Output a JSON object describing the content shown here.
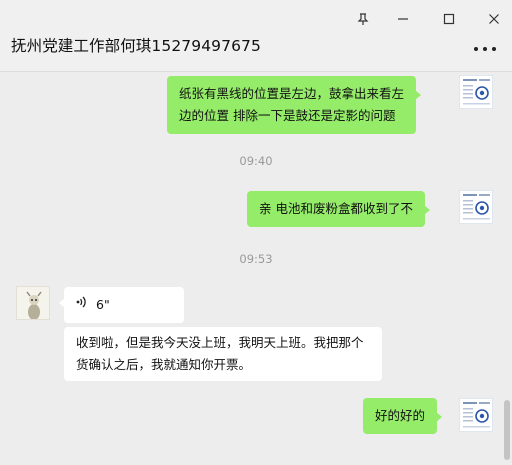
{
  "window": {
    "pin_icon": "pin-icon",
    "minimize_icon": "minimize-icon",
    "maximize_icon": "maximize-icon",
    "close_icon": "close-icon"
  },
  "header": {
    "title": "抚州党建工作部何琪15279497675",
    "more_icon": "more-dots-icon"
  },
  "messages": {
    "m1_line1": "纸张有黑线的位置是左边，鼓拿出来看左",
    "m1_line2": "边的位置 排除一下是鼓还是定影的问题",
    "time1": "09:40",
    "m2": "亲 电池和废粉盒都收到了不",
    "time2": "09:53",
    "voice_duration": "6\"",
    "m3_line1": "收到啦，但是我今天没上班，我明天上班。我把那个",
    "m3_line2": "货确认之后，我就通知你开票。",
    "m4": "好的好的"
  },
  "colors": {
    "my_bubble": "#95ec69",
    "other_bubble": "#ffffff",
    "background": "#ededed",
    "avatar_accent": "#2b57a8"
  }
}
